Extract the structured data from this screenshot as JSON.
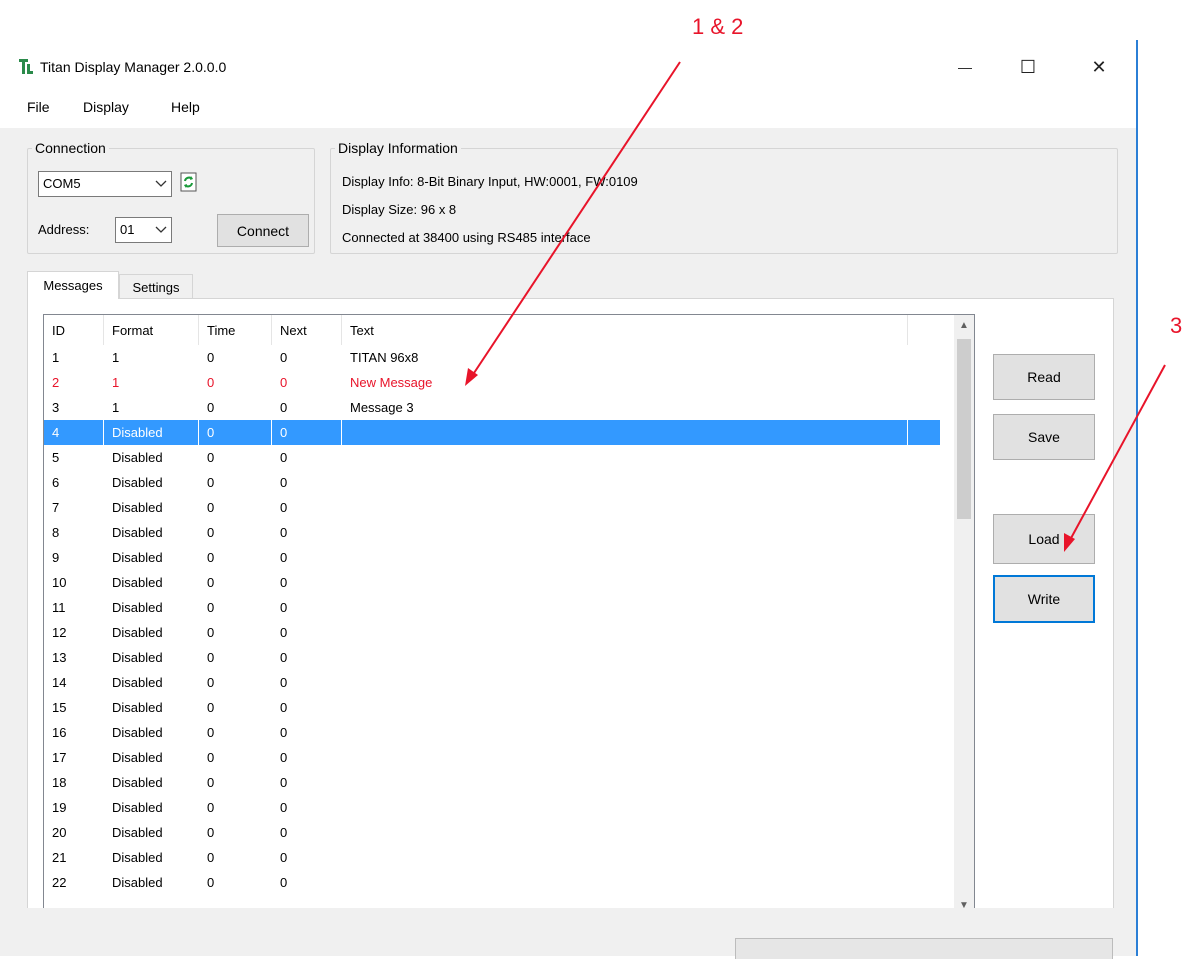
{
  "window": {
    "title": "Titan Display Manager  2.0.0.0",
    "minimize": "—",
    "maximize": "☐",
    "close": "✕"
  },
  "menu": [
    "File",
    "Display",
    "Help"
  ],
  "connection": {
    "legend": "Connection",
    "port": "COM5",
    "address_label": "Address:",
    "address": "01",
    "connect_button": "Connect"
  },
  "display_info": {
    "legend": "Display Information",
    "line1": "Display Info: 8-Bit Binary Input, HW:0001, FW:0109",
    "line2": "Display Size: 96 x 8",
    "line3": "Connected at 38400 using RS485 interface"
  },
  "tabs": [
    "Messages",
    "Settings"
  ],
  "table": {
    "columns": [
      "ID",
      "Format",
      "Time",
      "Next",
      "Text"
    ],
    "rows": [
      [
        "1",
        "1",
        "0",
        "0",
        "TITAN 96x8"
      ],
      [
        "2",
        "1",
        "0",
        "0",
        "New Message"
      ],
      [
        "3",
        "1",
        "0",
        "0",
        "Message 3"
      ],
      [
        "4",
        "Disabled",
        "0",
        "0",
        ""
      ],
      [
        "5",
        "Disabled",
        "0",
        "0",
        ""
      ],
      [
        "6",
        "Disabled",
        "0",
        "0",
        ""
      ],
      [
        "7",
        "Disabled",
        "0",
        "0",
        ""
      ],
      [
        "8",
        "Disabled",
        "0",
        "0",
        ""
      ],
      [
        "9",
        "Disabled",
        "0",
        "0",
        ""
      ],
      [
        "10",
        "Disabled",
        "0",
        "0",
        ""
      ],
      [
        "11",
        "Disabled",
        "0",
        "0",
        ""
      ],
      [
        "12",
        "Disabled",
        "0",
        "0",
        ""
      ],
      [
        "13",
        "Disabled",
        "0",
        "0",
        ""
      ],
      [
        "14",
        "Disabled",
        "0",
        "0",
        ""
      ],
      [
        "15",
        "Disabled",
        "0",
        "0",
        ""
      ],
      [
        "16",
        "Disabled",
        "0",
        "0",
        ""
      ],
      [
        "17",
        "Disabled",
        "0",
        "0",
        ""
      ],
      [
        "18",
        "Disabled",
        "0",
        "0",
        ""
      ],
      [
        "19",
        "Disabled",
        "0",
        "0",
        ""
      ],
      [
        "20",
        "Disabled",
        "0",
        "0",
        ""
      ],
      [
        "21",
        "Disabled",
        "0",
        "0",
        ""
      ],
      [
        "22",
        "Disabled",
        "0",
        "0",
        ""
      ]
    ],
    "selected_row": 3,
    "highlight_row": 1,
    "highlight_color": "#e8142a",
    "selection_color": "#3399ff"
  },
  "buttons": {
    "read": "Read",
    "save": "Save",
    "load": "Load",
    "write": "Write"
  },
  "annotations": {
    "label_1_2": "1 & 2",
    "label_3": "3",
    "color": "#e8142a"
  },
  "icons": {
    "app": "titan-logo-icon",
    "refresh": "refresh-ports-icon"
  }
}
